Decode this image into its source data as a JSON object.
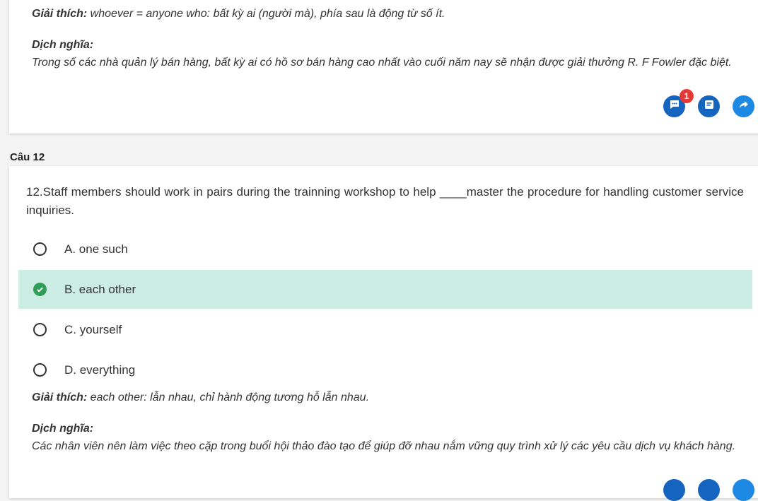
{
  "prev_explanation": {
    "label": "Giải thích:",
    "text": " whoever = anyone who: bất kỳ ai (người mà), phía sau là động từ số ít."
  },
  "prev_meaning": {
    "title": "Dịch nghĩa:",
    "text": "Trong số các nhà quản lý bán hàng, bất kỳ ai có hồ sơ bán hàng cao nhất vào cuối năm nay sẽ nhận được giải thưởng R. F Fowler đặc biệt."
  },
  "actions": {
    "comment_badge": "1",
    "icons": [
      "comment-icon",
      "note-icon",
      "share-icon"
    ],
    "accent": "#1565c0"
  },
  "question": {
    "section_label": "Câu 12",
    "text": "12.Staff members should work in pairs during the trainning workshop to help ____master the procedure for handling customer service inquiries.",
    "options": [
      {
        "label": "A. one such",
        "state": "unselected"
      },
      {
        "label": "B. each other",
        "state": "correct"
      },
      {
        "label": "C. yourself",
        "state": "unselected"
      },
      {
        "label": "D. everything",
        "state": "unselected"
      }
    ],
    "correct_bg": "#ccede3",
    "check_color": "#2e9e58"
  },
  "explanation": {
    "label": "Giải thích:",
    "text": " each other: lẫn nhau, chỉ hành động tương hỗ lẫn nhau."
  },
  "meaning": {
    "title": "Dịch nghĩa:",
    "text": "Các nhân viên nên làm việc theo cặp trong buổi hội thảo đào tạo để giúp đỡ nhau nắm vững quy trình xử lý các yêu cầu dịch vụ khách hàng."
  }
}
